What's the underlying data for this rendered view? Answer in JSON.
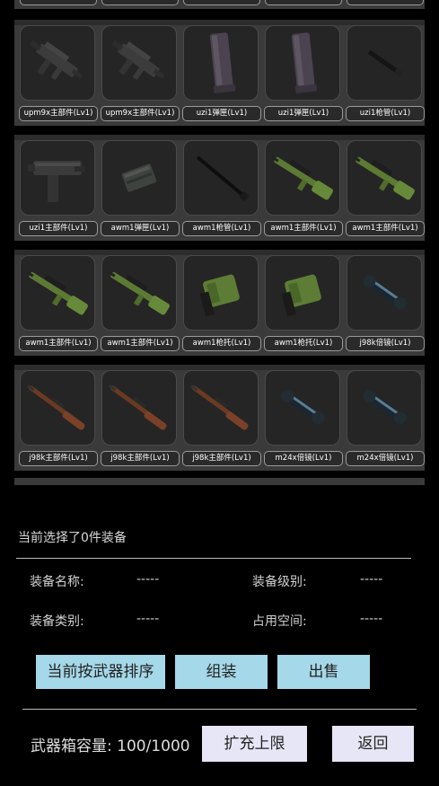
{
  "inventory": {
    "rows": [
      {
        "items": [
          {
            "label": "upm9x主部件(Lv1)",
            "icon": "smg-upm9x-icon"
          },
          {
            "label": "upm9x主部件(Lv1)",
            "icon": "smg-upm9x-icon"
          },
          {
            "label": "uzi1弹匣(Lv1)",
            "icon": "magazine-long-icon"
          },
          {
            "label": "uzi1弹匣(Lv1)",
            "icon": "magazine-long-icon"
          },
          {
            "label": "uzi1枪管(Lv1)",
            "icon": "barrel-short-icon"
          }
        ]
      },
      {
        "items": [
          {
            "label": "uzi1主部件(Lv1)",
            "icon": "smg-uzi-icon"
          },
          {
            "label": "awm1弹匣(Lv1)",
            "icon": "magazine-box-icon"
          },
          {
            "label": "awm1枪管(Lv1)",
            "icon": "barrel-long-icon"
          },
          {
            "label": "awm1主部件(Lv1)",
            "icon": "sniper-awm-icon"
          },
          {
            "label": "awm1主部件(Lv1)",
            "icon": "sniper-awm-icon"
          }
        ]
      },
      {
        "items": [
          {
            "label": "awm1主部件(Lv1)",
            "icon": "sniper-awm-icon"
          },
          {
            "label": "awm1主部件(Lv1)",
            "icon": "sniper-awm-icon"
          },
          {
            "label": "awm1枪托(Lv1)",
            "icon": "stock-icon"
          },
          {
            "label": "awm1枪托(Lv1)",
            "icon": "stock-icon"
          },
          {
            "label": "j98k倍镜(Lv1)",
            "icon": "scope-icon"
          }
        ]
      },
      {
        "items": [
          {
            "label": "j98k主部件(Lv1)",
            "icon": "rifle-kar98k-icon"
          },
          {
            "label": "j98k主部件(Lv1)",
            "icon": "rifle-kar98k-icon"
          },
          {
            "label": "j98k主部件(Lv1)",
            "icon": "rifle-kar98k-icon"
          },
          {
            "label": "m24x倍镜(Lv1)",
            "icon": "scope-icon"
          },
          {
            "label": "m24x倍镜(Lv1)",
            "icon": "scope-icon"
          }
        ]
      }
    ]
  },
  "selection": {
    "summary": "当前选择了0件装备",
    "name_label": "装备名称:",
    "name_value": "-----",
    "level_label": "装备级别:",
    "level_value": "-----",
    "type_label": "装备类别:",
    "type_value": "-----",
    "space_label": "占用空间:",
    "space_value": "-----"
  },
  "actions": {
    "sort": "当前按武器排序",
    "assemble": "组装",
    "sell": "出售",
    "capacity": "武器箱容量: 100/1000",
    "expand": "扩充上限",
    "back": "返回"
  },
  "colors": {
    "button_blue": "#a5d8e8",
    "button_light": "#e6e6f6",
    "panel": "#3a3a3a"
  }
}
